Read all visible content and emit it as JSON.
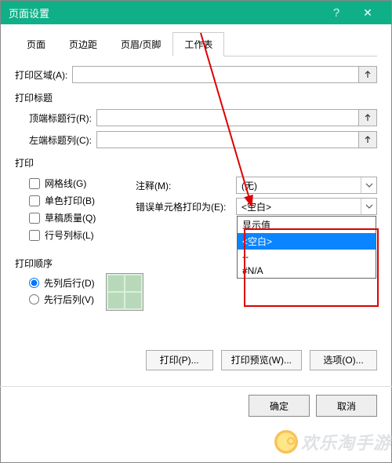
{
  "window": {
    "title": "页面设置",
    "help": "?",
    "close": "✕"
  },
  "tabs": {
    "items": [
      {
        "label": "页面"
      },
      {
        "label": "页边距"
      },
      {
        "label": "页眉/页脚"
      },
      {
        "label": "工作表"
      }
    ],
    "active": 3
  },
  "print_area": {
    "label": "打印区域(A):",
    "value": ""
  },
  "print_titles": {
    "group": "打印标题",
    "top_row_label": "顶端标题行(R):",
    "top_row_value": "",
    "left_col_label": "左端标题列(C):",
    "left_col_value": ""
  },
  "print": {
    "group": "打印",
    "gridlines": "网格线(G)",
    "bw": "单色打印(B)",
    "draft": "草稿质量(Q)",
    "rowcol": "行号列标(L)",
    "comments_label": "注释(M):",
    "comments_value": "(无)",
    "errors_label": "错误单元格打印为(E):",
    "errors_value": "<空白>",
    "errors_options": [
      "显示值",
      "<空白>",
      "--",
      "#N/A"
    ]
  },
  "order": {
    "group": "打印顺序",
    "col_first": "先列后行(D)",
    "row_first": "先行后列(V)"
  },
  "footer_buttons": {
    "print": "打印(P)...",
    "preview": "打印预览(W)...",
    "options": "选项(O)..."
  },
  "okcancel": {
    "ok": "确定",
    "cancel": "取消"
  },
  "watermark": "欢乐淘手游"
}
